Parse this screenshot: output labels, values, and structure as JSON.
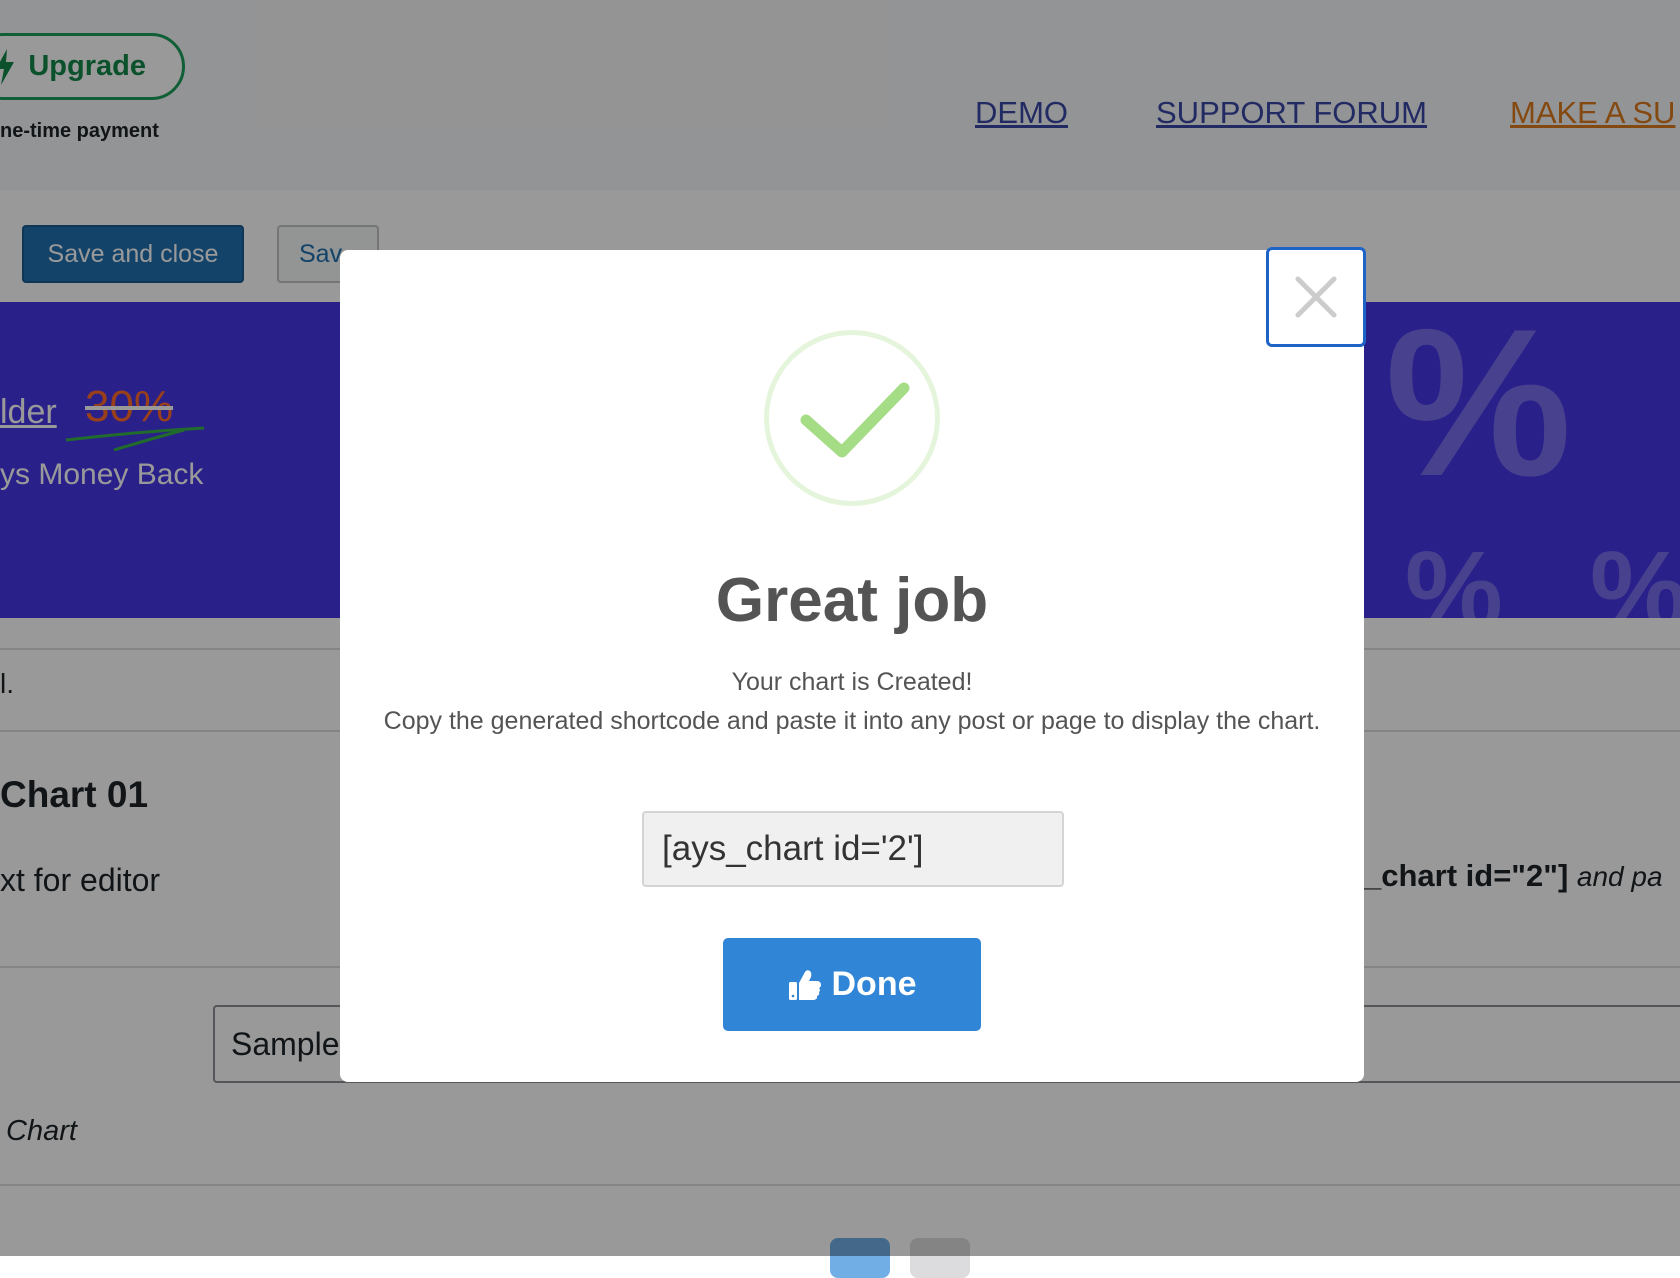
{
  "header": {
    "upgrade_label": "Upgrade",
    "payment_note": "ne-time payment",
    "links": {
      "demo": "DEMO",
      "support_forum": "SUPPORT FORUM",
      "suggest": "MAKE A SU"
    }
  },
  "toolbar": {
    "save_close_label": "Save and close",
    "save_label": "Sav"
  },
  "promo": {
    "title": "lder",
    "discount": "30%",
    "subtitle": "ys Money Back",
    "decoration": "%"
  },
  "content": {
    "notice": "l.",
    "chart_title": "Chart 01",
    "editor_text": "xt for editor",
    "shortcode_code": "_chart id=\"2\"]",
    "shortcode_after": "and pa",
    "name_input_value": "Sample",
    "chart_type_label": "Chart"
  },
  "modal": {
    "title": "Great job",
    "line1": "Your chart is Created!",
    "line2": "Copy the generated shortcode and paste it into any post or page to display the chart.",
    "shortcode_value": "[ays_chart id='2']",
    "done_label": "Done"
  },
  "colors": {
    "primary": "#2271b1",
    "promo_bg": "#4636e6",
    "upgrade_green": "#1d9e5a",
    "done_blue": "#3085d6",
    "success_green": "#a5dc86"
  },
  "icons": {
    "upgrade": "lightning-icon",
    "success": "checkmark-icon",
    "close": "close-icon",
    "done": "thumbs-up-icon"
  }
}
